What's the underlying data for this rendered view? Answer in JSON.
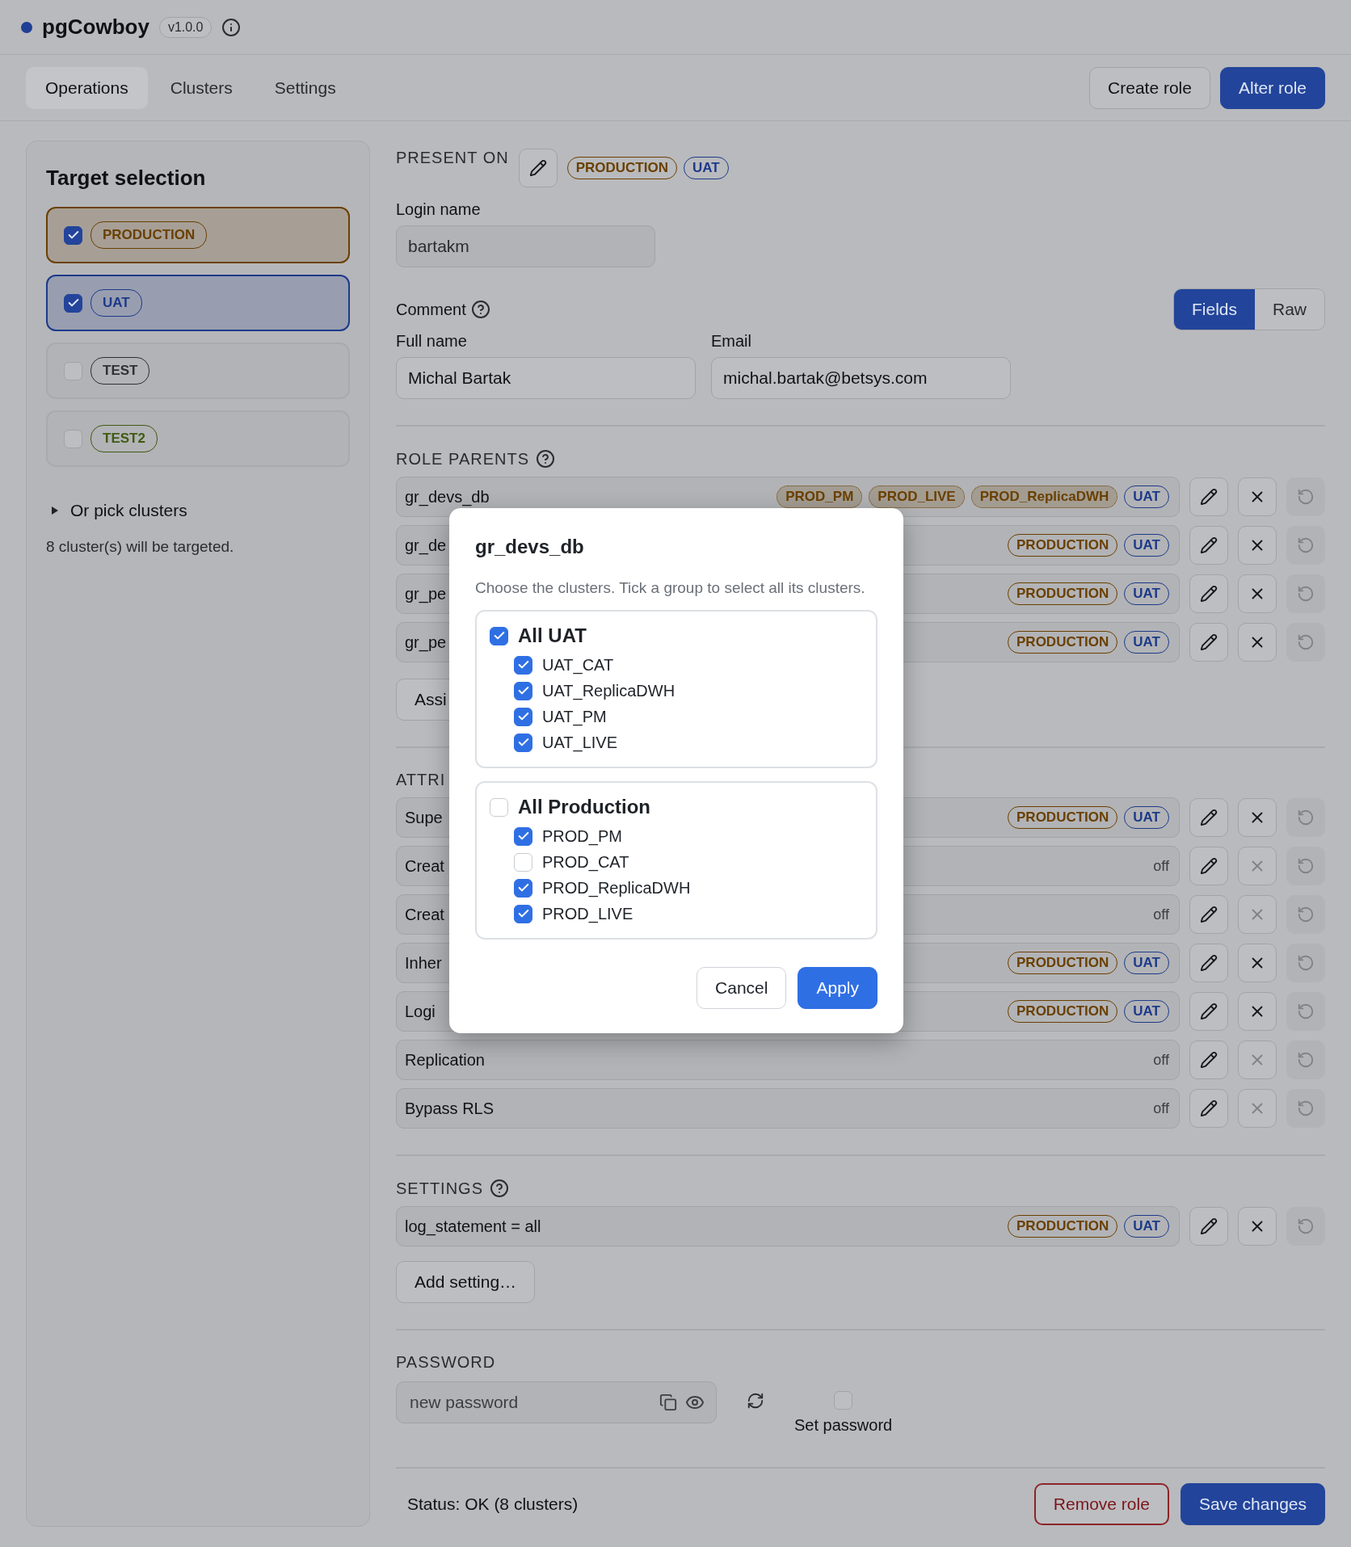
{
  "app": {
    "name": "pgCowboy",
    "version": "v1.0.0"
  },
  "nav_tabs": [
    {
      "label": "Operations",
      "selected": true
    },
    {
      "label": "Clusters",
      "selected": false
    },
    {
      "label": "Settings",
      "selected": false
    }
  ],
  "header_buttons": [
    {
      "label": "Create role",
      "kind": "secondary"
    },
    {
      "label": "Alter role",
      "kind": "primary"
    }
  ],
  "target_selection": {
    "title": "Target selection",
    "targets": [
      {
        "label": "PRODUCTION",
        "checked": true,
        "color": "#6a4000"
      },
      {
        "label": "UAT",
        "checked": true,
        "color": "#1d3a8a"
      },
      {
        "label": "TEST",
        "checked": false,
        "color": "#2e3035"
      },
      {
        "label": "TEST2",
        "checked": false,
        "color": "#3f5a12"
      }
    ],
    "disclosure": {
      "label": "Or pick clusters",
      "expanded": false
    },
    "summary": "8 cluster(s) will be targeted."
  },
  "present_on": {
    "label": "PRESENT ON",
    "tags": [
      {
        "label": "PRODUCTION",
        "kind": "env",
        "color": "#6a4000"
      },
      {
        "label": "UAT",
        "kind": "env",
        "color": "#1d3a8a"
      }
    ]
  },
  "login_name": {
    "label": "Login name",
    "value": "bartakm"
  },
  "comment": {
    "label": "Comment",
    "modes": [
      {
        "label": "Fields",
        "selected": true
      },
      {
        "label": "Raw",
        "selected": false
      }
    ],
    "fields": [
      {
        "label": "Full name",
        "value": "Michal Bartak"
      },
      {
        "label": "Email",
        "value": "michal.bartak@betsys.com"
      }
    ]
  },
  "role_parents": {
    "title": "ROLE PARENTS",
    "rows": [
      {
        "name": "gr_devs_db",
        "removable": true,
        "tags": [
          {
            "label": "PROD_PM",
            "kind": "cluster",
            "color": "#6a4000"
          },
          {
            "label": "PROD_LIVE",
            "kind": "cluster",
            "color": "#6a4000"
          },
          {
            "label": "PROD_ReplicaDWH",
            "kind": "cluster",
            "color": "#6a4000"
          },
          {
            "label": "UAT",
            "kind": "env",
            "color": "#1d3a8a"
          }
        ]
      },
      {
        "name": "gr_de",
        "removable": true,
        "tags": [
          {
            "label": "PRODUCTION",
            "kind": "env",
            "color": "#6a4000"
          },
          {
            "label": "UAT",
            "kind": "env",
            "color": "#1d3a8a"
          }
        ]
      },
      {
        "name": "gr_pe",
        "removable": true,
        "tags": [
          {
            "label": "PRODUCTION",
            "kind": "env",
            "color": "#6a4000"
          },
          {
            "label": "UAT",
            "kind": "env",
            "color": "#1d3a8a"
          }
        ]
      },
      {
        "name": "gr_pe",
        "removable": true,
        "tags": [
          {
            "label": "PRODUCTION",
            "kind": "env",
            "color": "#6a4000"
          },
          {
            "label": "UAT",
            "kind": "env",
            "color": "#1d3a8a"
          }
        ]
      }
    ],
    "assign_button": "Assi"
  },
  "attributes": {
    "title": "ATTRI",
    "rows": [
      {
        "name": "Supe",
        "removable": true,
        "tags": [
          {
            "label": "PRODUCTION",
            "kind": "env",
            "color": "#6a4000"
          },
          {
            "label": "UAT",
            "kind": "env",
            "color": "#1d3a8a"
          }
        ]
      },
      {
        "name": "Creat",
        "removable": false,
        "value": "off"
      },
      {
        "name": "Creat",
        "removable": false,
        "value": "off"
      },
      {
        "name": "Inher",
        "removable": true,
        "tags": [
          {
            "label": "PRODUCTION",
            "kind": "env",
            "color": "#6a4000"
          },
          {
            "label": "UAT",
            "kind": "env",
            "color": "#1d3a8a"
          }
        ]
      },
      {
        "name": "Logi",
        "removable": true,
        "tags": [
          {
            "label": "PRODUCTION",
            "kind": "env",
            "color": "#6a4000"
          },
          {
            "label": "UAT",
            "kind": "env",
            "color": "#1d3a8a"
          }
        ]
      },
      {
        "name": "Replication",
        "removable": false,
        "value": "off"
      },
      {
        "name": "Bypass RLS",
        "removable": false,
        "value": "off"
      }
    ]
  },
  "settings": {
    "title": "SETTINGS",
    "rows": [
      {
        "name": "log_statement = all",
        "removable": true,
        "tags": [
          {
            "label": "PRODUCTION",
            "kind": "env",
            "color": "#6a4000"
          },
          {
            "label": "UAT",
            "kind": "env",
            "color": "#1d3a8a"
          }
        ]
      }
    ],
    "add_button": "Add setting…"
  },
  "password": {
    "title": "PASSWORD",
    "placeholder": "new password",
    "set_password": {
      "label": "Set password",
      "checked": false
    }
  },
  "footer": {
    "status": "Status: OK (8 clusters)",
    "buttons": [
      {
        "label": "Remove role",
        "kind": "danger"
      },
      {
        "label": "Save changes",
        "kind": "primary"
      }
    ]
  },
  "dialog": {
    "title": "gr_devs_db",
    "description": "Choose the clusters. Tick a group to select all its clusters.",
    "groups": [
      {
        "label": "All UAT",
        "checked": true,
        "clusters": [
          {
            "label": "UAT_CAT",
            "checked": true
          },
          {
            "label": "UAT_ReplicaDWH",
            "checked": true
          },
          {
            "label": "UAT_PM",
            "checked": true
          },
          {
            "label": "UAT_LIVE",
            "checked": true
          }
        ]
      },
      {
        "label": "All Production",
        "checked": false,
        "clusters": [
          {
            "label": "PROD_PM",
            "checked": true
          },
          {
            "label": "PROD_CAT",
            "checked": false
          },
          {
            "label": "PROD_ReplicaDWH",
            "checked": true
          },
          {
            "label": "PROD_LIVE",
            "checked": true
          }
        ]
      }
    ],
    "buttons": [
      {
        "label": "Cancel",
        "kind": "secondary"
      },
      {
        "label": "Apply",
        "kind": "primary"
      }
    ]
  }
}
